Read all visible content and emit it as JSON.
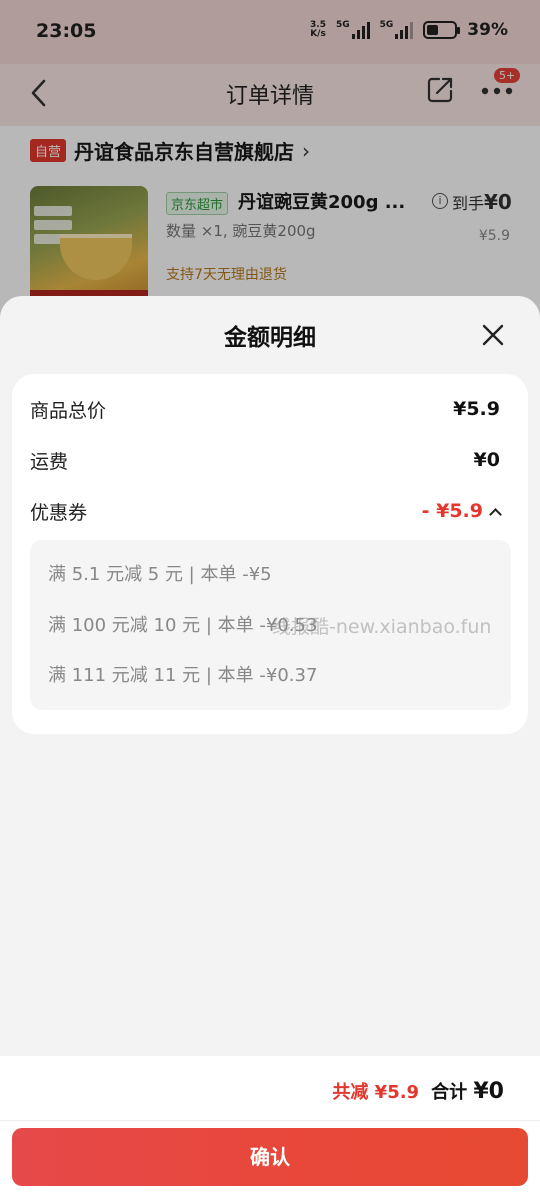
{
  "status_bar": {
    "time": "23:05",
    "speed_top": "3.5",
    "speed_bottom": "K/s",
    "net1": "5G",
    "net2": "5G",
    "battery": "39%"
  },
  "nav": {
    "title": "订单详情",
    "badge": "5+"
  },
  "store": {
    "tag": "自营",
    "name": "丹谊食品京东自营旗舰店",
    "chevron": "›"
  },
  "product": {
    "channel_tag": "京东超市",
    "title": "丹谊豌豆黄200g ...",
    "spec": "数量 ×1, 豌豆黄200g",
    "return_policy": "支持7天无理由退货",
    "daoshou_label": "到手",
    "daoshou_price": "¥0",
    "original_price": "¥5.9"
  },
  "sheet": {
    "title": "金额明细",
    "rows": [
      {
        "label": "商品总价",
        "value": "¥5.9"
      },
      {
        "label": "运费",
        "value": "¥0"
      },
      {
        "label": "优惠券",
        "value": "- ¥5.9"
      }
    ],
    "coupons": [
      "满 5.1 元减 5 元 | 本单 -¥5",
      "满 100 元减 10 元 | 本单 -¥0.53",
      "满 111 元减 11 元 | 本单 -¥0.37"
    ]
  },
  "watermark": "线报酷-new.xianbao.fun",
  "footer": {
    "reduce_label": "共减 ¥5.9",
    "total_label": "合计",
    "total_value": "¥0",
    "confirm": "确认"
  },
  "colors": {
    "accent_red": "#e3372d",
    "green_tag": "#2e9c3e",
    "return_text": "#b77b1e"
  }
}
